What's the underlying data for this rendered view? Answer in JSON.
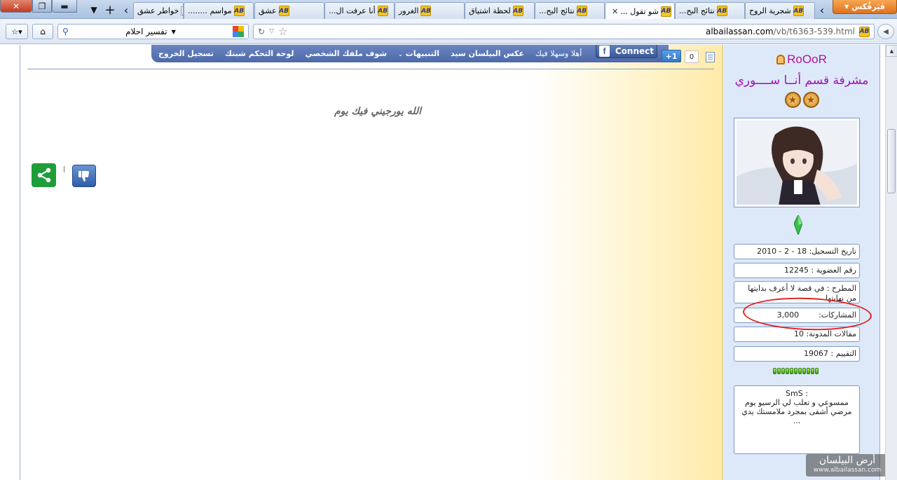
{
  "browser": {
    "firefox_label": "فَيَرفُكس",
    "tabs": [
      {
        "title": "خواطر عشق",
        "favicon": "dotted-square-icon"
      },
      {
        "title": "مواسم ........",
        "favicon": "site-icon"
      },
      {
        "title": "عشق",
        "favicon": "site-icon"
      },
      {
        "title": "أنا عرفت ال...",
        "favicon": "site-icon"
      },
      {
        "title": "الغرور",
        "favicon": "site-icon"
      },
      {
        "title": "لحظة اشتياق",
        "favicon": "site-icon"
      },
      {
        "title": "نتائج البح...",
        "favicon": "site-icon"
      },
      {
        "title": "شو تقول ...",
        "favicon": "site-icon",
        "active": true
      },
      {
        "title": "نتائج البح...",
        "favicon": "site-icon"
      },
      {
        "title": "شجرية الروح",
        "favicon": "site-icon"
      }
    ],
    "search_value": "تفسير احلام",
    "url_domain": "albailassan.com",
    "url_path": "/vb/t6363-539.html",
    "favicon_text": "AB"
  },
  "post": {
    "userbar": {
      "greeting": "أهلا وسهلا فيك",
      "username_mask": "عكس البيلسان سيد",
      "alerts": "التنبيهات",
      "profile": "شوف ملفك الشخصي",
      "control_panel": "لوحة التحكم شبتك",
      "logout": "تسجيل الخروج"
    },
    "fb_connect": "Connect",
    "fb_letter": "f",
    "gplus": "+1",
    "like_count": "0",
    "message": "الله يورجيني فيك يوم"
  },
  "sidebar": {
    "username": "RoOoR",
    "title": "مشرفة قسم أنــا ســــوري",
    "info": {
      "register_date": "تاريخ التسجيل:  18 - 2 - 2010",
      "member_no": "رقم العضوية : 12245",
      "location": "المطرح : في قصة لا أعرف بدايتها من نهايتها",
      "posts_label": "المشاركات:",
      "posts_value": "3,000",
      "blog": "مقالات المدونة:  10",
      "rating": "التقييم : 19067"
    },
    "sms_label": "SmS :",
    "sms_text": "ممسوعي و تعلب لي الرسيو يوم مرضي أشفى بمجرد ملامستك يدي ..."
  },
  "watermark": {
    "name": "أرض البيلسان",
    "url": "www.albailassan.com"
  },
  "colors": {
    "userbar": "#5470b0",
    "username": "#b0129b",
    "annotation": "#e02020"
  }
}
